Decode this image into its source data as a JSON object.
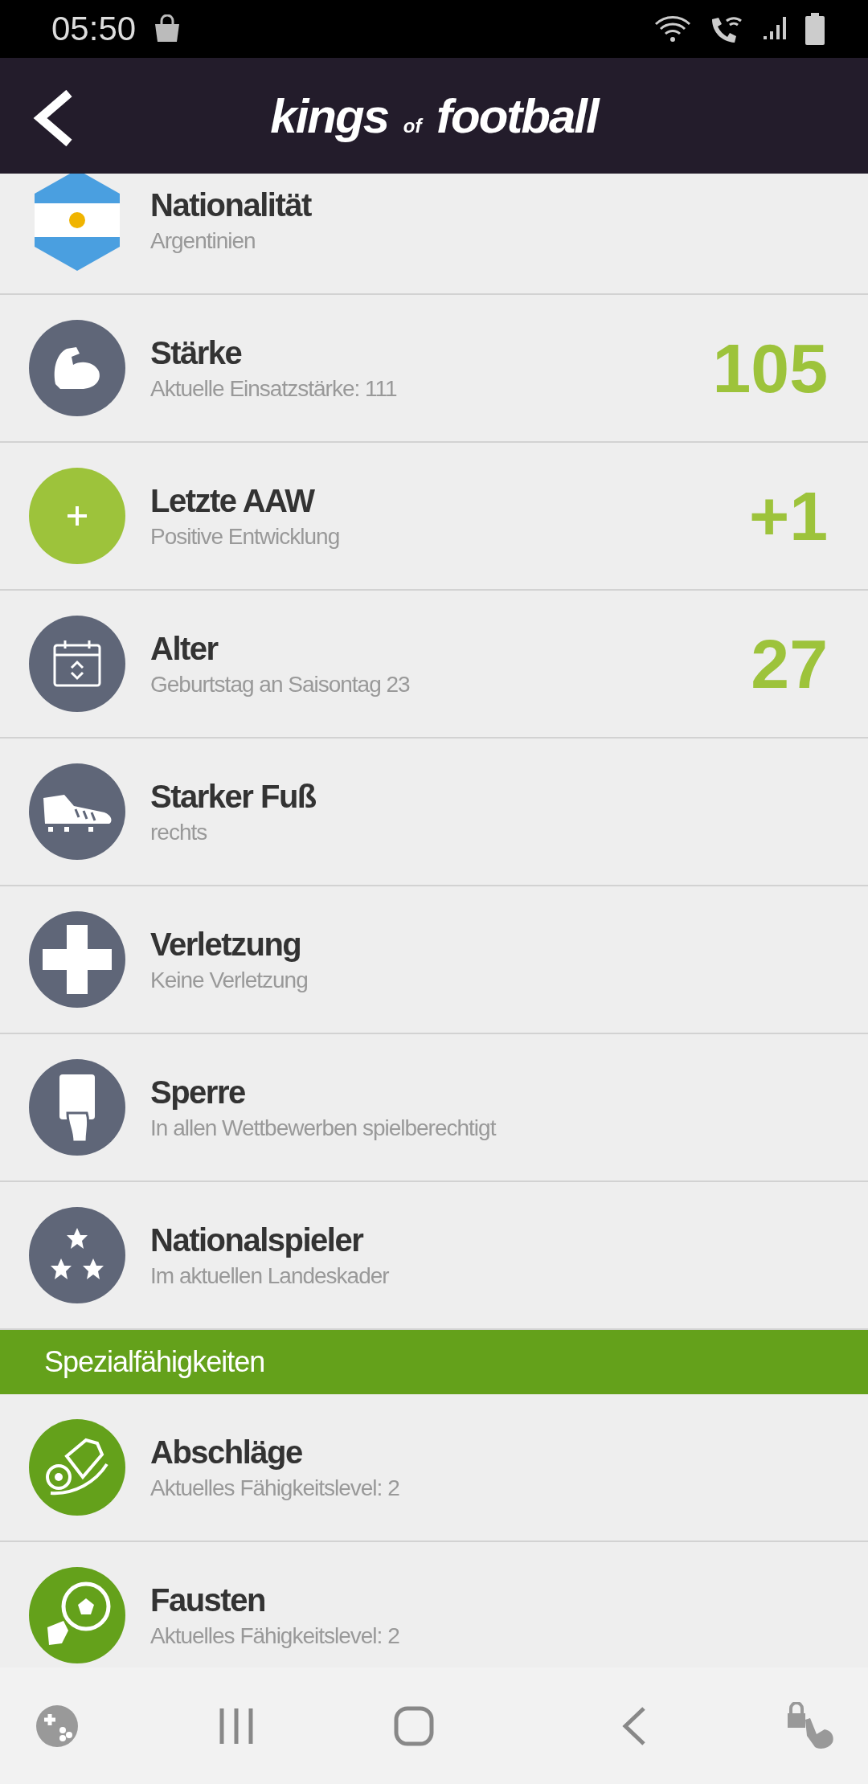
{
  "status_bar": {
    "time": "05:50"
  },
  "header": {
    "logo": "kings $_{of}$ football"
  },
  "rows": [
    {
      "kind": "flag",
      "title": "Nationalität",
      "subtitle": "Argentinien"
    },
    {
      "kind": "muscle",
      "title": "Stärke",
      "subtitle": "Aktuelle Einsatzstärke: 111",
      "value": "105"
    },
    {
      "kind": "plus",
      "title": "Letzte AAW",
      "subtitle": "Positive Entwicklung",
      "value": "+1"
    },
    {
      "kind": "calendar",
      "title": "Alter",
      "subtitle": "Geburtstag an Saisontag 23",
      "value": "27"
    },
    {
      "kind": "boot",
      "title": "Starker Fuß",
      "subtitle": "rechts"
    },
    {
      "kind": "cross",
      "title": "Verletzung",
      "subtitle": "Keine Verletzung"
    },
    {
      "kind": "card",
      "title": "Sperre",
      "subtitle": "In allen Wettbewerben spielberechtigt"
    },
    {
      "kind": "stars",
      "title": "Nationalspieler",
      "subtitle": "Im aktuellen Landeskader"
    }
  ],
  "section": {
    "title": "Spezialfähigkeiten",
    "rows": [
      {
        "kind": "kick",
        "title": "Abschläge",
        "subtitle": "Aktuelles Fähigkeitslevel: 2"
      },
      {
        "kind": "punch",
        "title": "Fausten",
        "subtitle": "Aktuelles Fähigkeitslevel: 2"
      }
    ]
  }
}
